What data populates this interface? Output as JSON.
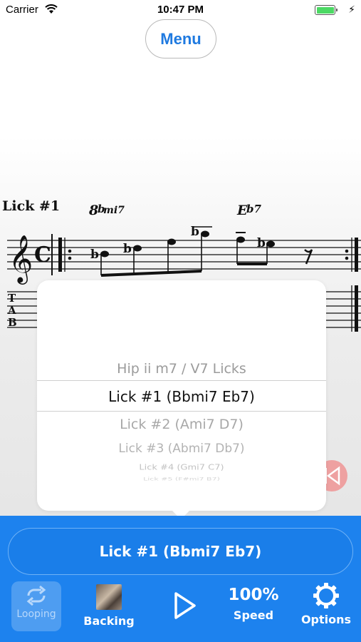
{
  "status_bar": {
    "carrier": "Carrier",
    "time": "10:47 PM",
    "battery_icon": "battery-full-icon",
    "charging_icon": "charging-bolt-icon"
  },
  "menu_button": {
    "label": "Menu",
    "color": "#1f7ae0"
  },
  "score": {
    "title": "Lick #1",
    "chords": [
      "Bbmi7",
      "Eb7"
    ],
    "tab_letters": [
      "T",
      "A",
      "B"
    ]
  },
  "picker": {
    "rows": [
      {
        "label": "Hip ii m7 / V7 Licks",
        "selected": false
      },
      {
        "label": "Lick #1 (Bbmi7 Eb7)",
        "selected": true
      },
      {
        "label": "Lick #2 (Ami7 D7)",
        "selected": false
      },
      {
        "label": "Lick #3 (Abmi7 Db7)",
        "selected": false
      },
      {
        "label": "Lick #4 (Gmi7 C7)",
        "selected": false
      },
      {
        "label": "Lick #5 (F#mi7 B7)",
        "selected": false
      }
    ]
  },
  "current_lick": "Lick #1 (Bbmi7 Eb7)",
  "toolbar": {
    "looping_label": "Looping",
    "backing_label": "Backing",
    "speed_value": "100%",
    "speed_label": "Speed",
    "options_label": "Options",
    "accent": "#1d82ee"
  }
}
